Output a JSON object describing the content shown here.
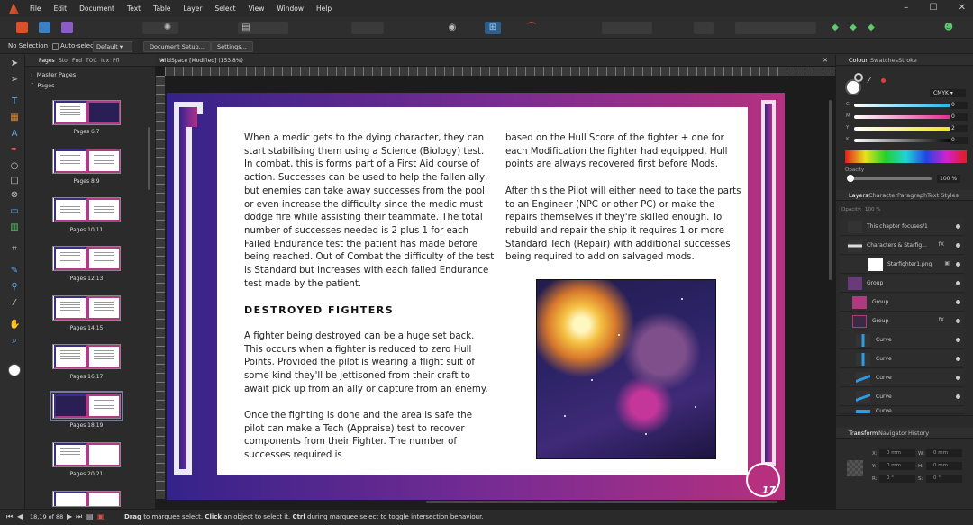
{
  "menu": [
    "File",
    "Edit",
    "Document",
    "Text",
    "Table",
    "Layer",
    "Select",
    "View",
    "Window",
    "Help"
  ],
  "context": {
    "selection": "No Selection",
    "auto_select_label": "Auto-select:",
    "auto_select_value": "Default",
    "document_setup": "Document Setup...",
    "settings": "Settings..."
  },
  "pages_panel": {
    "tabs": [
      "Pages",
      "Sto",
      "Fnd",
      "TOC",
      "Idx",
      "Pfl"
    ],
    "master_pages": "Master Pages",
    "pages": "Pages",
    "thumbs": [
      "Pages 6,7",
      "Pages 8,9",
      "Pages 10,11",
      "Pages 12,13",
      "Pages 14,15",
      "Pages 16,17",
      "Pages 18,19",
      "Pages 20,21"
    ],
    "page_count": "18,19 of 88"
  },
  "doc": {
    "tab_title": "WildSpace [Modified] (153.8%)",
    "col1_p1": "When a medic gets to the dying character, they can start stabilising them using a Science (Biology) test. In combat, this is forms part of a First Aid course of action. Successes can be used to help the fallen ally, but enemies can take away successes from the pool or even increase the difficulty since the medic must dodge fire while assisting their teammate. The total number of successes needed is 2 plus 1 for each Failed Endurance test the patient has made before being reached. Out of Combat the difficulty of the test is Standard but increases with each failed Endurance test made by the patient.",
    "heading": "Destroyed Fighters",
    "col1_p2": "A fighter being destroyed can be a huge set back. This occurs when a fighter is reduced to zero Hull Points. Provided the pilot is wearing a flight suit of some kind they'll be jettisoned from their craft to await pick up from an ally or capture from an enemy.",
    "col1_p3": "Once the fighting is done and the area is safe the pilot can make a Tech (Appraise) test to recover components from their Fighter. The number of successes required is",
    "col2_p1": "based on the Hull Score of the fighter + one for each Modification the fighter had equipped. Hull points are always recovered first before Mods.",
    "col2_p2": "After this the Pilot will either need to take the parts to an Engineer (NPC or other PC) or make the repairs themselves if they're skilled enough. To rebuild and repair the ship it requires 1 or more Standard Tech (Repair) with additional successes being required to add on salvaged mods.",
    "page_number": "17"
  },
  "colour_panel": {
    "tabs": [
      "Colour",
      "Swatches",
      "Stroke"
    ],
    "model": "CMYK",
    "channels": [
      {
        "label": "C",
        "value": "0"
      },
      {
        "label": "M",
        "value": "0"
      },
      {
        "label": "Y",
        "value": "2"
      },
      {
        "label": "K",
        "value": "0"
      }
    ],
    "opacity_label": "Opacity",
    "opacity_value": "100 %"
  },
  "layers_panel": {
    "tabs": [
      "Layers",
      "Character",
      "Paragraph",
      "Text Styles"
    ],
    "opacity": "Opacity:",
    "opacity_value": "100 %",
    "rows": [
      {
        "name": "This chapter focuses/1",
        "fx": ""
      },
      {
        "name": "Characters & Starfig...",
        "fx": "fX"
      },
      {
        "name": "Starfighter1.png",
        "fx": ""
      },
      {
        "name": "Group",
        "fx": ""
      },
      {
        "name": "Group",
        "fx": ""
      },
      {
        "name": "Group",
        "fx": "fX"
      },
      {
        "name": "Curve",
        "fx": ""
      },
      {
        "name": "Curve",
        "fx": ""
      },
      {
        "name": "Curve",
        "fx": ""
      },
      {
        "name": "Curve",
        "fx": ""
      },
      {
        "name": "Curve",
        "fx": ""
      }
    ]
  },
  "transform_panel": {
    "tabs": [
      "Transform",
      "Navigator",
      "History"
    ],
    "fields": [
      {
        "label": "X:",
        "value": "0 mm"
      },
      {
        "label": "W:",
        "value": "0 mm"
      },
      {
        "label": "Y:",
        "value": "0 mm"
      },
      {
        "label": "H:",
        "value": "0 mm"
      },
      {
        "label": "R:",
        "value": "0 °"
      },
      {
        "label": "S:",
        "value": "0 °"
      }
    ]
  },
  "status": {
    "drag": "Drag",
    "text1": " to marquee select. ",
    "click": "Click",
    "text2": " an object to select it. ",
    "ctrl": "Ctrl",
    "text3": " during marquee select to toggle intersection behaviour."
  }
}
